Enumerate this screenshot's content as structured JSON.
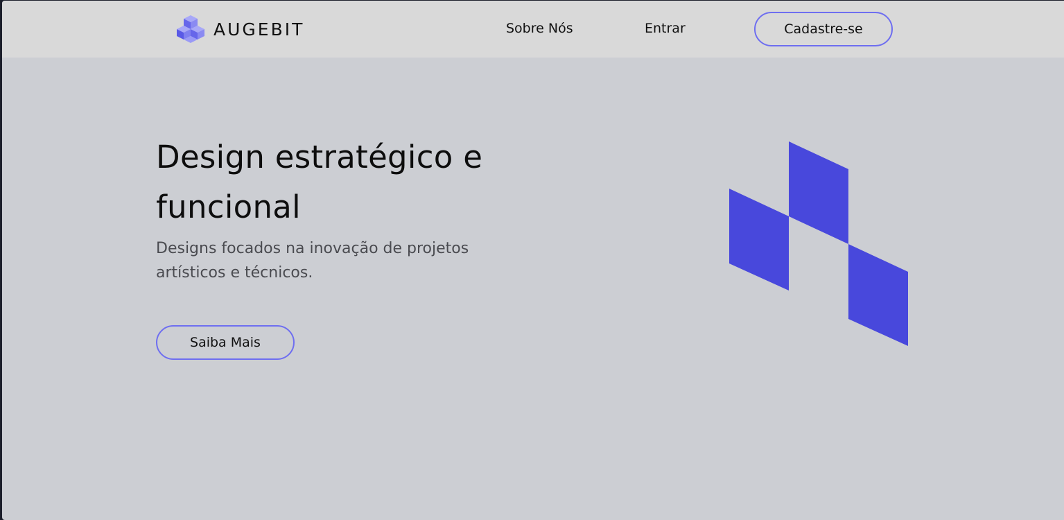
{
  "brand": {
    "name": "AUGEBIT",
    "logo_icon": "isometric-cubes-icon",
    "color": "#4848dc"
  },
  "nav": {
    "about_label": "Sobre Nós",
    "login_label": "Entrar",
    "signup_label": "Cadastre-se"
  },
  "hero": {
    "title": "Design estratégico e funcional",
    "subtitle": "Designs focados na inovação de projetos artísticos e técnicos.",
    "cta_label": "Saiba Mais",
    "illustration_icon": "isometric-stairs-illustration"
  },
  "colors": {
    "accent": "#6e6ef0",
    "illustration": "#4848dc",
    "header_bg": "#d9d9d9",
    "page_bg": "#ccced3"
  }
}
